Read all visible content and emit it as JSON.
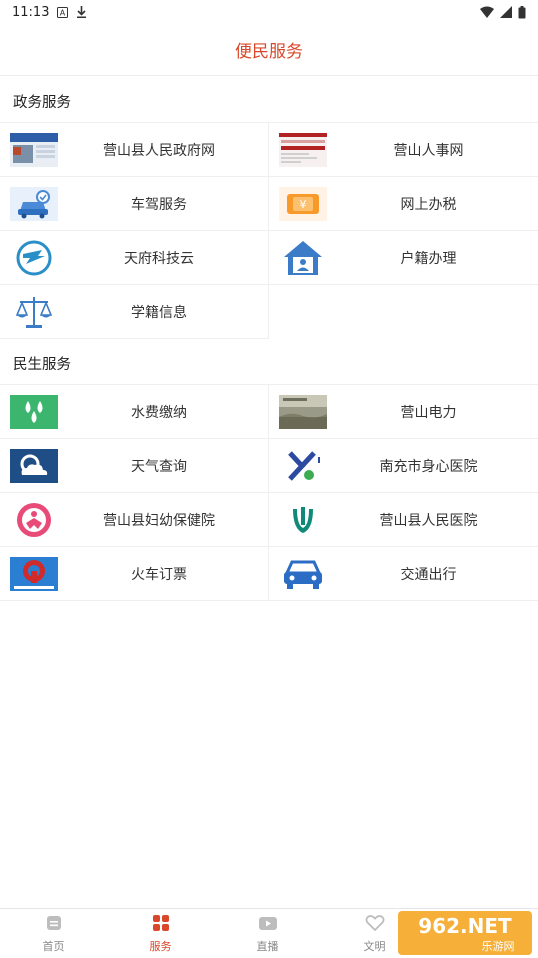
{
  "status_bar": {
    "time": "11:13"
  },
  "header": {
    "title": "便民服务"
  },
  "sections": [
    {
      "title": "政务服务",
      "items": [
        {
          "label": "营山县人民政府网",
          "icon": "government-site-thumbnail-icon"
        },
        {
          "label": "营山人事网",
          "icon": "personnel-site-thumbnail-icon"
        },
        {
          "label": "车驾服务",
          "icon": "car-service-icon"
        },
        {
          "label": "网上办税",
          "icon": "tax-ticket-icon"
        },
        {
          "label": "天府科技云",
          "icon": "tianfu-tech-cloud-icon"
        },
        {
          "label": "户籍办理",
          "icon": "household-registration-house-icon"
        },
        {
          "label": "学籍信息",
          "icon": "scales-icon"
        }
      ]
    },
    {
      "title": "民生服务",
      "items": [
        {
          "label": "水费缴纳",
          "icon": "water-drops-icon"
        },
        {
          "label": "营山电力",
          "icon": "power-company-thumbnail-icon"
        },
        {
          "label": "天气查询",
          "icon": "weather-cloud-icon"
        },
        {
          "label": "南充市身心医院",
          "icon": "hospital-logo-icon"
        },
        {
          "label": "营山县妇幼保健院",
          "icon": "maternal-child-hospital-icon"
        },
        {
          "label": "营山县人民医院",
          "icon": "people-hospital-logo-icon"
        },
        {
          "label": "火车订票",
          "icon": "railway-logo-icon"
        },
        {
          "label": "交通出行",
          "icon": "car-front-icon"
        }
      ]
    }
  ],
  "tabbar": {
    "items": [
      {
        "label": "首页",
        "icon": "home-document-icon",
        "active": false
      },
      {
        "label": "服务",
        "icon": "grid-services-icon",
        "active": true
      },
      {
        "label": "直播",
        "icon": "video-play-icon",
        "active": false
      },
      {
        "label": "文明",
        "icon": "heart-icon",
        "active": false
      }
    ]
  },
  "watermark": {
    "text": "962.NET",
    "subtext": "乐游网"
  },
  "colors": {
    "accent": "#d9482b",
    "icon_blue": "#2b6cc4",
    "water_green": "#3cb56f",
    "divider": "#efefef"
  }
}
